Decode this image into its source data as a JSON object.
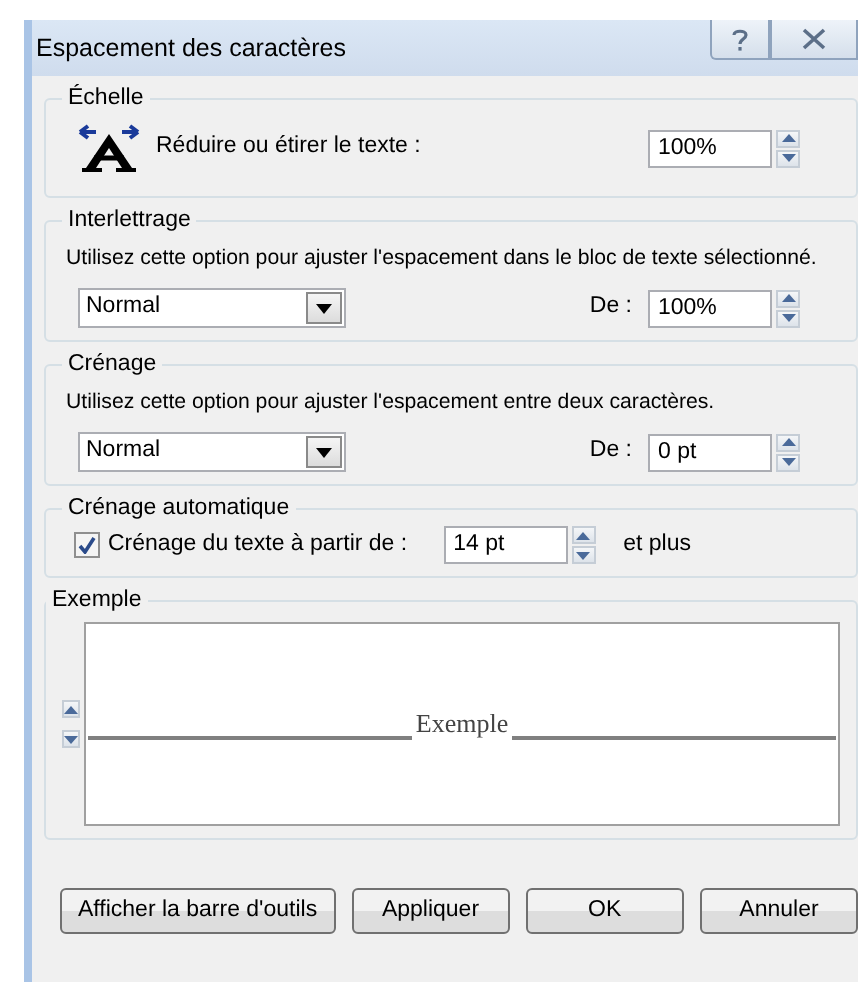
{
  "window": {
    "title": "Espacement des caractères"
  },
  "groups": [
    {
      "kind": "scale",
      "legend": "Échelle",
      "label": "Réduire ou étirer le texte :",
      "value": "100%"
    },
    {
      "kind": "spacing",
      "legend": "Interlettrage",
      "description": "Utilisez cette option pour ajuster l'espacement dans le bloc de texte sélectionné.",
      "dropdown": "Normal",
      "value_label": "De :",
      "value": "100%"
    },
    {
      "kind": "spacing",
      "legend": "Crénage",
      "description": "Utilisez cette option pour ajuster l'espacement entre deux caractères.",
      "dropdown": "Normal",
      "value_label": "De :",
      "value": "0 pt"
    },
    {
      "kind": "auto",
      "legend": "Crénage automatique",
      "checked": true,
      "label": "Crénage du texte à partir de :",
      "value": "14 pt",
      "suffix": "et plus"
    },
    {
      "kind": "sample",
      "legend": "Exemple",
      "sample_text": "Exemple"
    }
  ],
  "buttons": [
    "Afficher la barre d'outils",
    "Appliquer",
    "OK",
    "Annuler"
  ]
}
